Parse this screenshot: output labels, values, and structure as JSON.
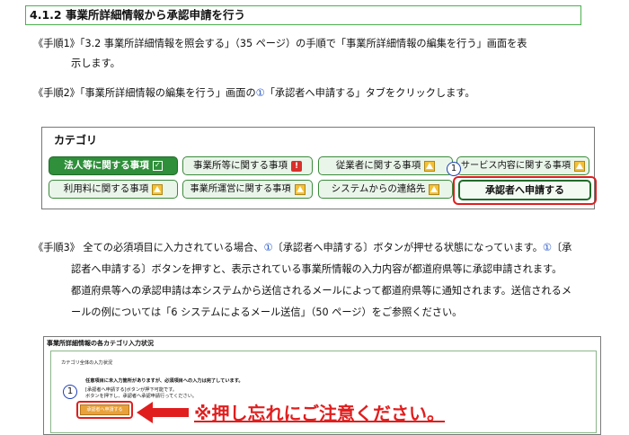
{
  "section": {
    "number": "4.1.2",
    "title": "事業所詳細情報から承認申請を行う"
  },
  "steps": {
    "step1_l1": "《手順1》「3.2 事業所詳細情報を照会する」（35 ページ）の手順で「事業所詳細情報の編集を行う」画面を表",
    "step1_l2": "示します。",
    "step2_pre": "《手順2》「事業所詳細情報の編集を行う」画面の",
    "step2_circ": "①",
    "step2_post": "「承認者へ申請する」タブをクリックします。",
    "step3_l1_a": "《手順3》 全ての必須項目に入力されている場合、",
    "step3_l1_c1": "①",
    "step3_l1_b": "〔承認者へ申請する〕ボタンが押せる状態になっています。",
    "step3_l1_c2": "①",
    "step3_l1_c": "〔承",
    "step3_l2": "認者へ申請する〕ボタンを押すと、表示されている事業所情報の入力内容が都道府県等に承認申請されます。",
    "step3_l3": "都道府県等への承認申請は本システムから送信されるメールによって都道府県等に通知されます。送信されるメ",
    "step3_l4": "ールの例については「6 システムによるメール送信」（50 ページ）をご参照ください。"
  },
  "category_panel": {
    "title": "カテゴリ",
    "tabs": {
      "corporate": "法人等に関する事項",
      "office": "事業所等に関する事項",
      "employee": "従業者に関する事項",
      "service": "サービス内容に関する事項",
      "fee": "利用料に関する事項",
      "operation": "事業所運営に関する事項",
      "contact": "システムからの連絡先",
      "apply": "承認者へ申請する"
    },
    "marker": "1"
  },
  "screenshot": {
    "title": "事業所詳細情報の各カテゴリ入力状況",
    "subtitle": "カテゴリ全体の入力状況",
    "msg_bold": "任意項目に未入力箇所がありますが、必須項目への入力は完了しています。",
    "msg_1": "[承認者へ申請する]ボタンが押下可能です。",
    "msg_2": "ボタンを押下し、承認者へ承認申請行ってください。",
    "apply_button": "承認者へ申請する",
    "marker": "1"
  },
  "caution": "※押し忘れにご注意ください。",
  "colors": {
    "accent_green": "#2f8f3a",
    "highlight_red": "#e01e1e",
    "circle_blue": "#2455c8"
  }
}
